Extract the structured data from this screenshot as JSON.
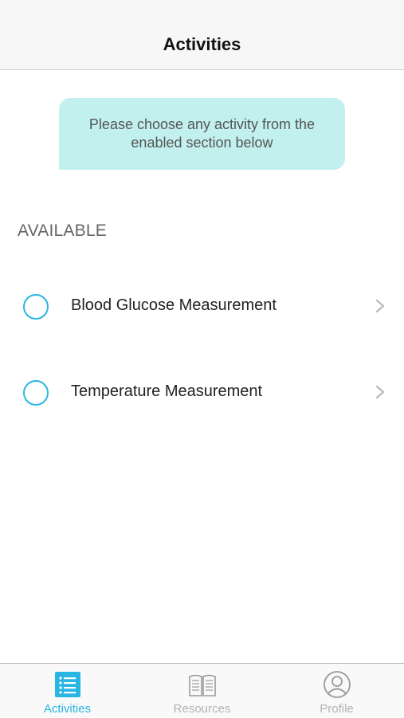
{
  "nav": {
    "title": "Activities"
  },
  "banner": {
    "text": "Please choose any activity from the enabled section below"
  },
  "section": {
    "header": "AVAILABLE"
  },
  "activities": [
    {
      "label": "Blood Glucose Measurement",
      "status_icon": "circle-outline-icon",
      "chevron_icon": "chevron-right-icon"
    },
    {
      "label": "Temperature Measurement",
      "status_icon": "circle-outline-icon",
      "chevron_icon": "chevron-right-icon"
    }
  ],
  "tabs": [
    {
      "label": "Activities",
      "icon": "list-icon",
      "active": true
    },
    {
      "label": "Resources",
      "icon": "book-icon",
      "active": false
    },
    {
      "label": "Profile",
      "icon": "user-icon",
      "active": false
    }
  ],
  "colors": {
    "accent": "#29b6e3",
    "banner_bg": "#c2f0ef",
    "tab_inactive": "#b3b3b3",
    "nav_bg": "#f7f7f7"
  }
}
